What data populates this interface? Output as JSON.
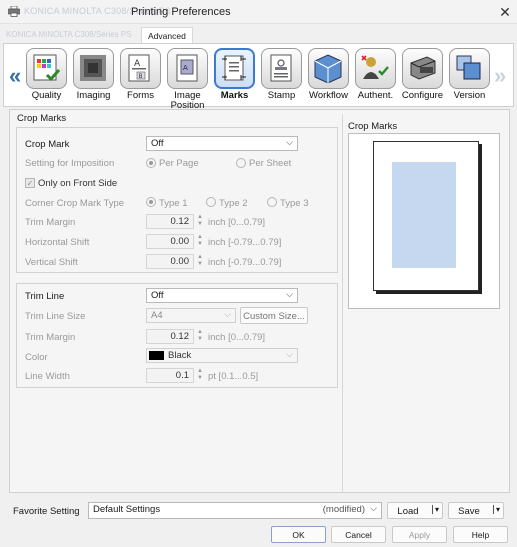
{
  "window": {
    "model_name": "KONICA MINOLTA C308/Series PS",
    "title": "Printing Preferences",
    "close_glyph": "✕",
    "port_name": "KONICA MINOLTA C308/Series PS",
    "advanced_tab": "Advanced"
  },
  "toolbar": {
    "nav_left": "«",
    "nav_right": "»",
    "tabs": [
      {
        "label": "Quality",
        "icon": "quality-icon"
      },
      {
        "label": "Imaging",
        "icon": "imaging-icon"
      },
      {
        "label": "Forms",
        "icon": "forms-icon"
      },
      {
        "label": "Image Position",
        "icon": "image-position-icon"
      },
      {
        "label": "Marks",
        "icon": "marks-icon",
        "selected": true
      },
      {
        "label": "Stamp",
        "icon": "stamp-icon"
      },
      {
        "label": "Workflow",
        "icon": "workflow-icon"
      },
      {
        "label": "Authent.",
        "icon": "authentication-icon"
      },
      {
        "label": "Configure",
        "icon": "configure-icon"
      },
      {
        "label": "Version",
        "icon": "version-icon"
      }
    ]
  },
  "crop_marks": {
    "section_title": "Crop Marks",
    "crop_mark_label": "Crop Mark",
    "crop_mark_value": "Off",
    "imposition_label": "Setting for Imposition",
    "per_page": "Per Page",
    "per_sheet": "Per Sheet",
    "only_front_label": "Only on Front Side",
    "corner_type_label": "Corner Crop Mark Type",
    "type1": "Type 1",
    "type2": "Type 2",
    "type3": "Type 3",
    "trim_margin_label": "Trim Margin",
    "trim_margin_value": "0.12",
    "trim_margin_unit": "inch [0...0.79]",
    "hshift_label": "Horizontal Shift",
    "hshift_value": "0.00",
    "hshift_unit": "inch [-0.79...0.79]",
    "vshift_label": "Vertical Shift",
    "vshift_value": "0.00",
    "vshift_unit": "inch [-0.79...0.79]"
  },
  "trim_line": {
    "trim_line_label": "Trim Line",
    "trim_line_value": "Off",
    "size_label": "Trim Line Size",
    "size_value": "A4",
    "custom_size_button": "Custom Size...",
    "margin_label": "Trim Margin",
    "margin_value": "0.12",
    "margin_unit": "inch [0...0.79]",
    "color_label": "Color",
    "color_value": "Black",
    "color_swatch": "#000000",
    "line_width_label": "Line Width",
    "line_width_value": "0.1",
    "line_width_unit": "pt [0.1...0.5]"
  },
  "preview": {
    "title": "Crop Marks",
    "page_fill": "#c6d8ef"
  },
  "footer": {
    "favorite_label": "Favorite Setting",
    "favorite_value": "Default Settings",
    "favorite_status": "(modified)",
    "load_button": "Load",
    "save_button": "Save",
    "ok_button": "OK",
    "cancel_button": "Cancel",
    "apply_button": "Apply",
    "help_button": "Help"
  }
}
